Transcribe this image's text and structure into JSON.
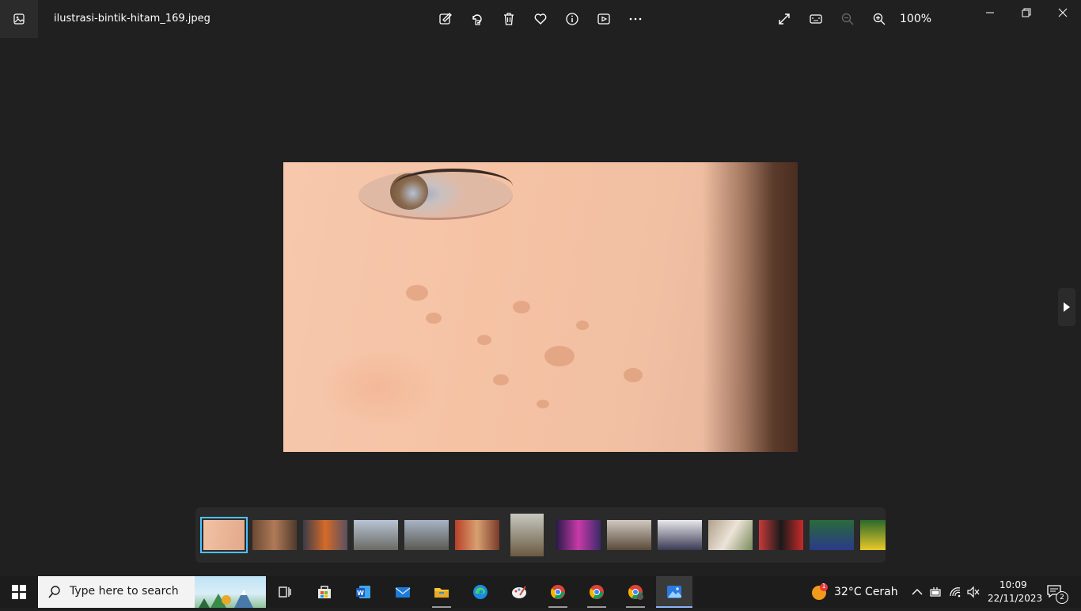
{
  "window": {
    "filename": "ilustrasi-bintik-hitam_169.jpeg",
    "zoom": "100%"
  },
  "toolbar": {
    "icons": [
      "edit-image-icon",
      "rotate-icon",
      "delete-icon",
      "favorite-icon",
      "info-icon",
      "slideshow-icon",
      "more-icon"
    ],
    "right_icons": [
      "fullscreen-icon",
      "fit-window-icon",
      "zoom-out-icon",
      "zoom-in-icon"
    ]
  },
  "filmstrip": {
    "selected_index": 0,
    "count": 14
  },
  "taskbar": {
    "search_placeholder": "Type here to search",
    "apps": [
      "task-view",
      "microsoft-store",
      "word",
      "mail",
      "file-explorer",
      "edge",
      "paint",
      "chrome",
      "chrome",
      "chrome",
      "photos"
    ],
    "weather": {
      "temp_text": "32°C  Cerah",
      "badge": "1"
    },
    "clock": {
      "time": "10:09",
      "date": "22/11/2023"
    },
    "notification_count": "2"
  },
  "colors": {
    "background": "#202020",
    "accent": "#4cc2ff",
    "taskbar": "#1c1c1c"
  }
}
